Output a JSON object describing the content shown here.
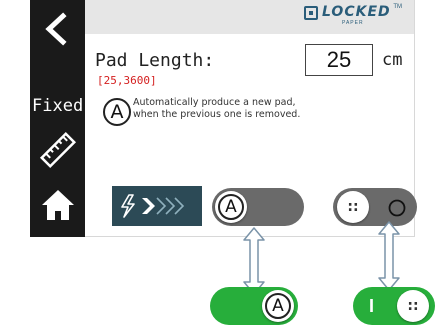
{
  "sidebar": {
    "back_icon": "chevron-left-icon",
    "mode_label": "Fixed",
    "ruler_icon": "ruler-icon",
    "home_icon": "home-icon"
  },
  "logo": {
    "brand": "LOCKED",
    "sub": "PAPER",
    "tm": "TM"
  },
  "pad_length": {
    "label": "Pad Length:",
    "range": "[25,3600]",
    "value": "25",
    "unit": "cm"
  },
  "auto_mode": {
    "badge": "A",
    "description_line1": "Automatically produce a new pad,",
    "description_line2": "when the previous one is removed."
  },
  "toolbar": {
    "feed_icon": "feed-lightning-icon",
    "auto_toggle_knob": "A",
    "pause_toggle_knob": "::",
    "auto_toggle_on_knob": "A",
    "pause_toggle_on_knob": "::",
    "pause_toggle_on_mark": "I"
  },
  "colors": {
    "sidebar_bg": "#1a1a1a",
    "topbar_bg": "#e6e6e6",
    "toggle_off": "#6a6a6a",
    "toggle_on": "#27ae3b",
    "feed_bg": "#2c4a56",
    "range_red": "#d42020",
    "logo_blue": "#2a5d7a"
  }
}
